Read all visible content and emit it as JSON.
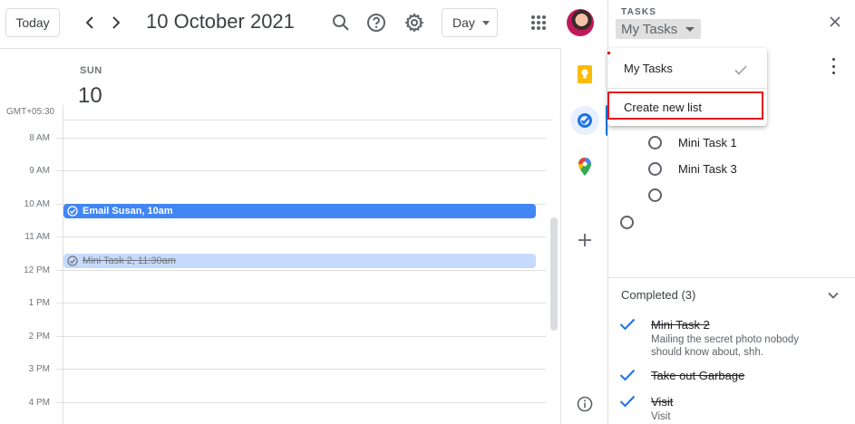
{
  "header": {
    "today_label": "Today",
    "date_title": "10 October 2021",
    "view_label": "Day"
  },
  "day": {
    "dow": "SUN",
    "dom": "10",
    "timezone": "GMT+05:30"
  },
  "hours": [
    "8 AM",
    "9 AM",
    "10 AM",
    "11 AM",
    "12 PM",
    "1 PM",
    "2 PM",
    "3 PM",
    "4 PM"
  ],
  "events": [
    {
      "label": "Email Susan, 10am",
      "color": "#4285f4",
      "completed": false
    },
    {
      "label": "Mini Task 2, 11:30am",
      "color": "#c6dafc",
      "completed": true
    }
  ],
  "tasks_panel": {
    "section_label": "TASKS",
    "list_name": "My Tasks",
    "open_tasks": [
      "Mini Task 1",
      "Mini Task 3",
      "",
      ""
    ],
    "completed_header": "Completed (3)",
    "completed": [
      {
        "title": "Mini Task 2",
        "note": "Mailing the secret photo nobody should know about, shh."
      },
      {
        "title": "Take out Garbage",
        "note": ""
      },
      {
        "title": "Visit",
        "note": "Visit"
      }
    ]
  },
  "dropdown": {
    "items": [
      "My Tasks",
      "Create new list"
    ],
    "selected": "My Tasks",
    "highlighted": "Create new list"
  },
  "colors": {
    "accent": "#1a73e8",
    "event_blue": "#4285f4",
    "highlight": "#e8111b"
  }
}
